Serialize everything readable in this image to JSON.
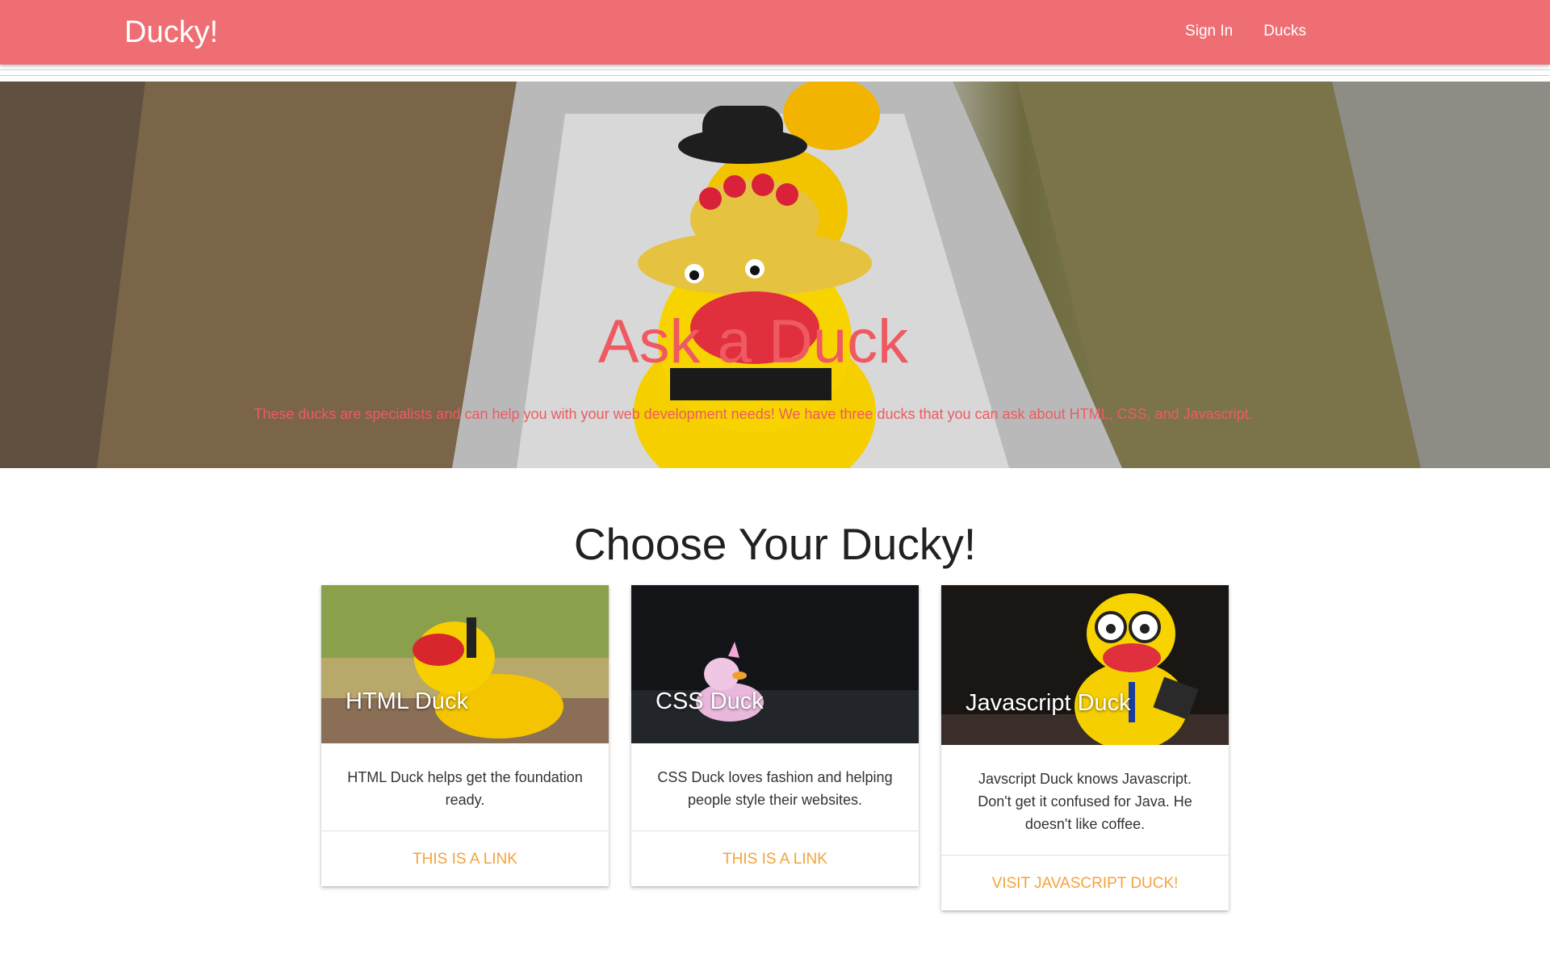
{
  "navbar": {
    "brand": "Ducky!",
    "links": [
      "Sign In",
      "Ducks"
    ]
  },
  "hero": {
    "title": "Ask a Duck",
    "subtitle": "These ducks are specialists and can help you with your web development needs! We have three ducks that you can ask about HTML, CSS, and Javascript."
  },
  "section": {
    "title": "Choose Your Ducky!"
  },
  "cards": [
    {
      "title": "HTML Duck",
      "description": "HTML Duck helps get the foundation ready.",
      "link": "THIS IS A LINK"
    },
    {
      "title": "CSS Duck",
      "description": "CSS Duck loves fashion and helping people style their websites.",
      "link": "THIS IS A LINK"
    },
    {
      "title": "Javascript Duck",
      "description": "Javscript Duck knows Javascript. Don't get it confused for Java. He doesn't like coffee.",
      "link": "VISIT JAVASCRIPT DUCK!"
    }
  ],
  "colors": {
    "navbar": "#ef6e73",
    "hero_text": "#ef5a62",
    "link": "#f4a23c"
  }
}
